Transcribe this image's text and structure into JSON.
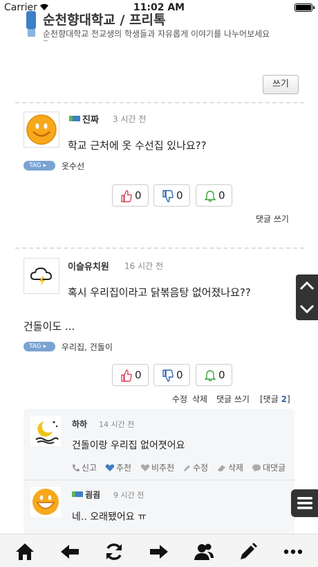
{
  "status_bar": {
    "carrier": "Carrier",
    "time": "11:02 AM"
  },
  "header": {
    "title": "순천향대학교 / 프리톡",
    "description": "순천향대학교 전교생의 학생들과 자유롭게 이야기를 나누어보세요",
    "tilde": "~"
  },
  "write_button": "쓰기",
  "posts": [
    {
      "author": "진짜",
      "time": "3 시간 전",
      "body": "학교 근처에 옷 수선집 있나요??",
      "tag_label": "TAG",
      "tags": "옷수선",
      "upvotes": "0",
      "downvotes": "0",
      "alerts": "0",
      "reply_write": "댓글 쓰기"
    },
    {
      "author": "이슬유치원",
      "time": "16 시간 전",
      "body": "혹시 우리집이라고 닭볶음탕 없어졌나요??",
      "body2": "건돌이도 ...",
      "tag_label": "TAG",
      "tags": "우리집,  건돌이",
      "upvotes": "0",
      "downvotes": "0",
      "alerts": "0",
      "edit": "수정",
      "delete": "삭제",
      "reply_write": "댓글 쓰기",
      "reply_label": "[댓글",
      "reply_count": "2",
      "reply_close": "]"
    }
  ],
  "comments": [
    {
      "author": "하하",
      "time": "14 시간 전",
      "body": "건돌이랑 우리집 없어졋어요",
      "actions": {
        "report": "신고",
        "recommend": "추천",
        "not_recommend": "비추천",
        "edit": "수정",
        "delete": "삭제",
        "reply": "대댓글"
      }
    },
    {
      "author": "굄굄",
      "time": "9 시간 전",
      "body": "네.. 오래됐어요 ㅠ"
    }
  ],
  "colors": {
    "accent": "#3d7fc5",
    "tag": "#7aa3d3",
    "dark_ctrl": "#333333",
    "upvote": "#e0445a",
    "downvote": "#2f65b0",
    "alert": "#3aa53a"
  },
  "icons": [
    "home-icon",
    "back-arrow-icon",
    "refresh-icon",
    "forward-arrow-icon",
    "users-icon",
    "pencil-icon",
    "more-icon",
    "chevron-up-icon",
    "chevron-down-icon",
    "menu-icon"
  ]
}
